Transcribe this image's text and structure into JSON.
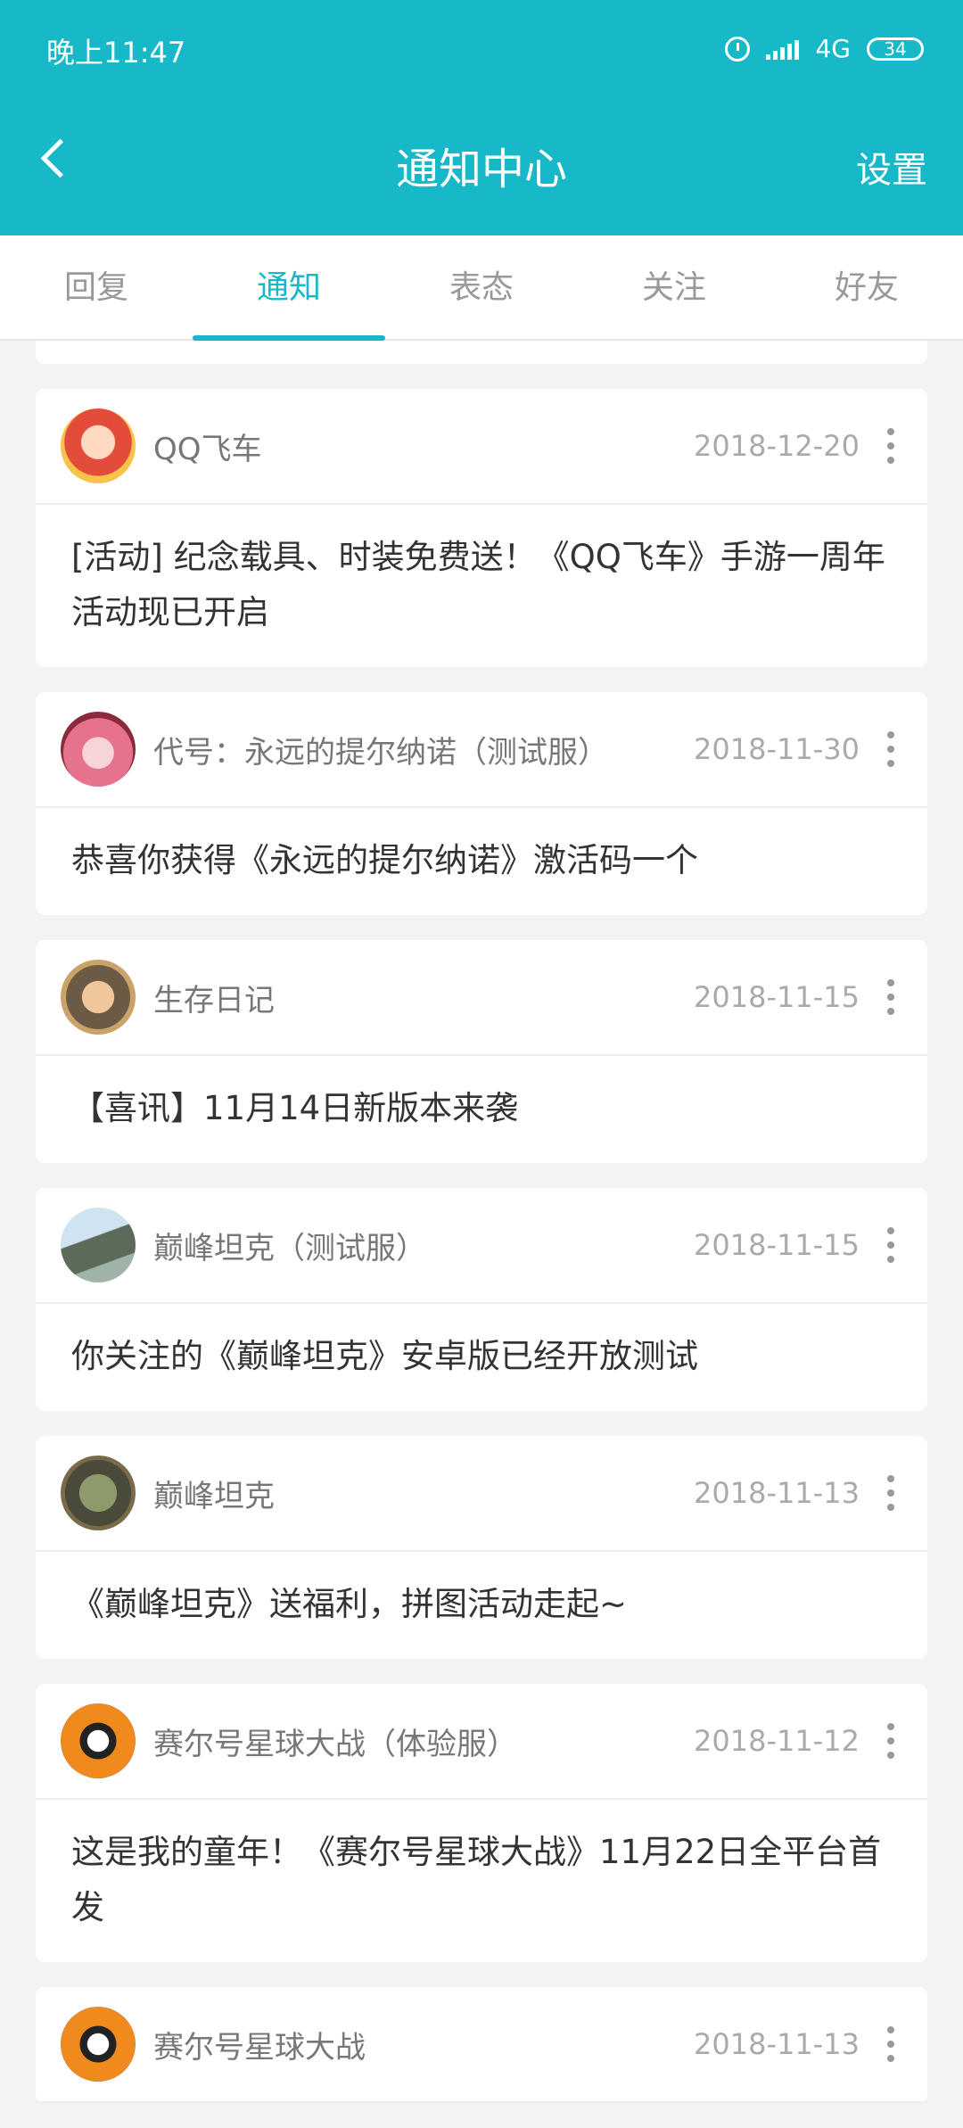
{
  "status": {
    "time": "晚上11:47",
    "network": "4G",
    "battery": "34"
  },
  "header": {
    "title": "通知中心",
    "settings": "设置"
  },
  "tabs": [
    {
      "label": "回复"
    },
    {
      "label": "通知"
    },
    {
      "label": "表态"
    },
    {
      "label": "关注"
    },
    {
      "label": "好友"
    }
  ],
  "active_tab": "通知",
  "colors": {
    "accent": "#17b8c8"
  },
  "notifications": [
    {
      "name": "QQ飞车",
      "date": "2018-12-20",
      "text": "[活动] 纪念载具、时装免费送！《QQ飞车》手游一周年活动现已开启"
    },
    {
      "name": "代号：永远的提尔纳诺（测试服）",
      "date": "2018-11-30",
      "text": "恭喜你获得《永远的提尔纳诺》激活码一个"
    },
    {
      "name": "生存日记",
      "date": "2018-11-15",
      "text": "【喜讯】11月14日新版本来袭"
    },
    {
      "name": "巅峰坦克（测试服）",
      "date": "2018-11-15",
      "text": "你关注的《巅峰坦克》安卓版已经开放测试"
    },
    {
      "name": "巅峰坦克",
      "date": "2018-11-13",
      "text": "《巅峰坦克》送福利，拼图活动走起~"
    },
    {
      "name": "赛尔号星球大战（体验服）",
      "date": "2018-11-12",
      "text": "这是我的童年！《赛尔号星球大战》11月22日全平台首发"
    },
    {
      "name": "赛尔号星球大战",
      "date": "2018-11-13",
      "text": ""
    }
  ]
}
